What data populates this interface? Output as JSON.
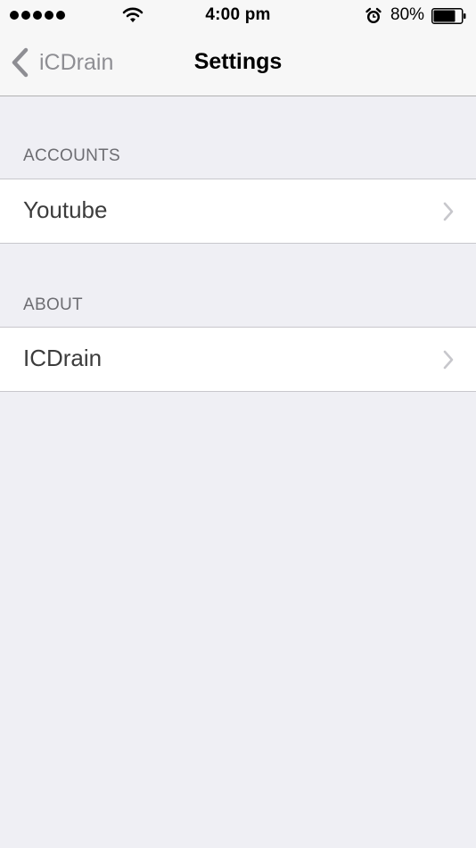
{
  "status_bar": {
    "signal_icon": "signal-dots-icon",
    "wifi_icon": "wifi-icon",
    "time": "4:00 pm",
    "alarm_icon": "alarm-icon",
    "battery_percent": "80%",
    "battery_level": 0.8,
    "battery_icon": "battery-icon"
  },
  "nav": {
    "back_label": "iCDrain",
    "title": "Settings"
  },
  "sections": [
    {
      "header": "ACCOUNTS",
      "items": [
        {
          "label": "Youtube"
        }
      ]
    },
    {
      "header": "ABOUT",
      "items": [
        {
          "label": "ICDrain"
        }
      ]
    }
  ],
  "colors": {
    "background": "#efeff4",
    "header_background": "#f7f7f7",
    "cell_background": "#ffffff",
    "secondary_text": "#8e8e93",
    "section_header_text": "#6d6d72",
    "chevron": "#c7c7cc"
  }
}
